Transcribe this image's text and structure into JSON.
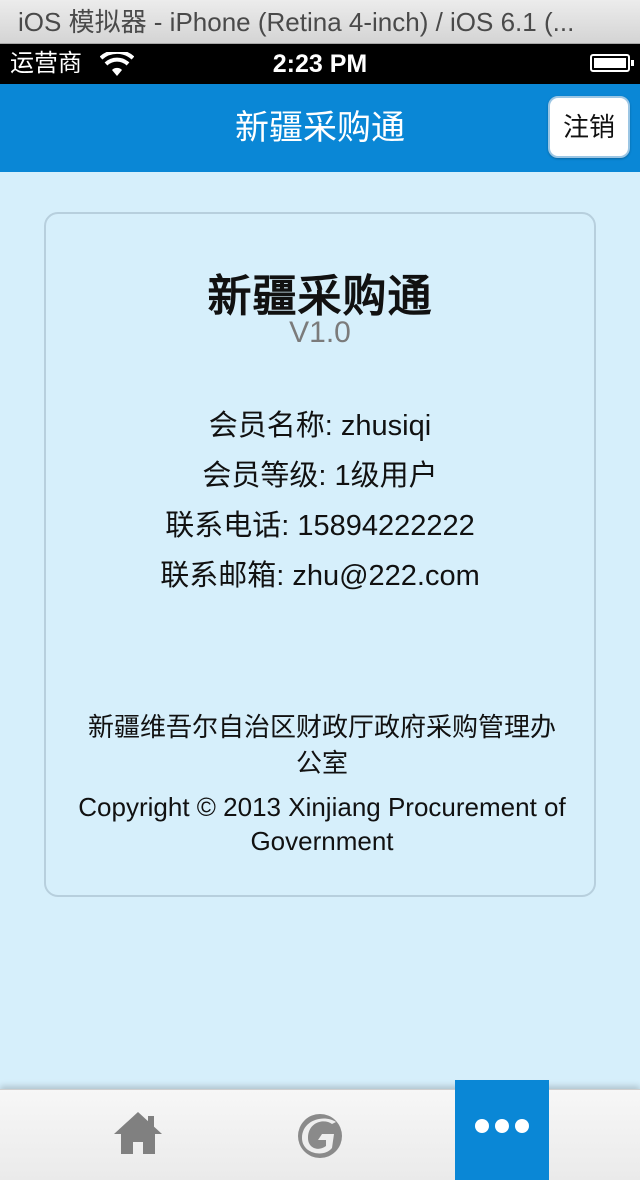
{
  "simulator": {
    "window_title": "iOS 模拟器 - iPhone (Retina 4-inch) / iOS 6.1 (..."
  },
  "status_bar": {
    "carrier": "运营商",
    "time": "2:23 PM"
  },
  "header": {
    "title": "新疆采购通",
    "logout_label": "注销"
  },
  "about": {
    "app_name": "新疆采购通",
    "version": "V1.0",
    "member_name": "会员名称: zhusiqi",
    "member_level": "会员等级: 1级用户",
    "phone": "联系电话: 15894222222",
    "email": "联系邮箱: zhu@222.com",
    "organization": "新疆维吾尔自治区财政厅政府采购管理办公室",
    "copyright": "Copyright © 2013 Xinjiang Procurement of Government"
  },
  "tabs": [
    {
      "icon": "home-icon",
      "active": false
    },
    {
      "icon": "app-logo-icon",
      "active": false
    },
    {
      "icon": "more-icon",
      "active": true
    }
  ],
  "colors": {
    "header_bg": "#0a87d6",
    "page_bg": "#d6effb",
    "tab_active_bg": "#0a87d6"
  }
}
